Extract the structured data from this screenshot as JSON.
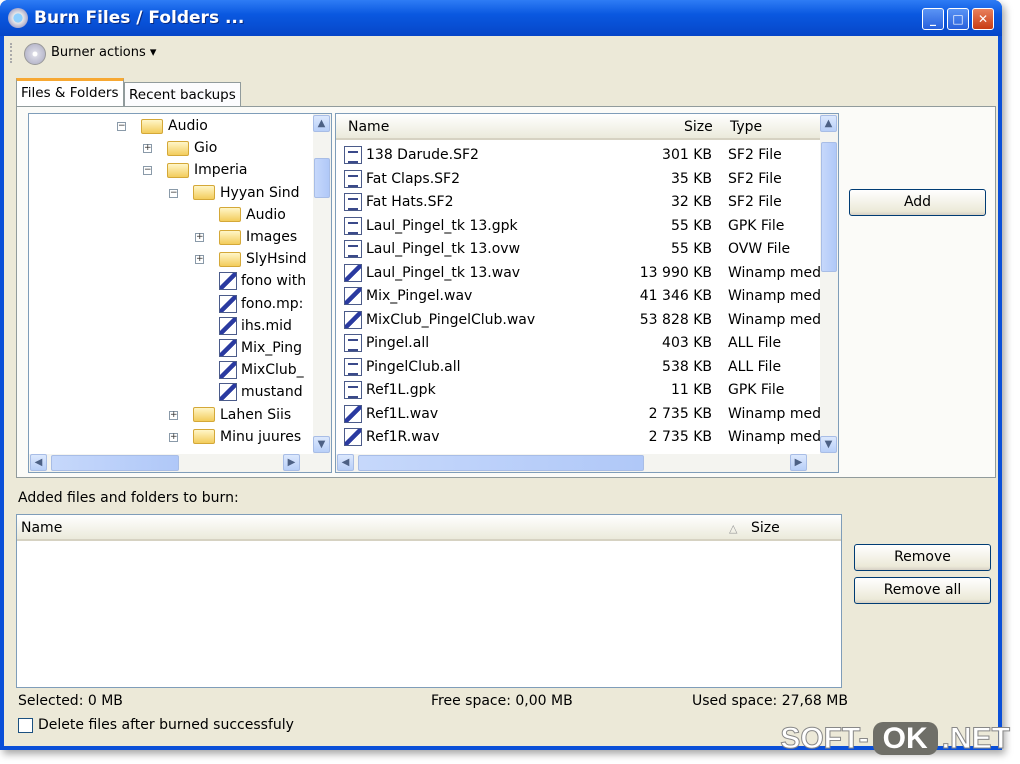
{
  "window": {
    "title": "Burn Files / Folders ...",
    "minimize": "_",
    "maximize": "□",
    "close": "✕"
  },
  "toolbar": {
    "burner_actions": "Burner actions ▾"
  },
  "tabs": [
    {
      "label": "Files & Folders",
      "active": true
    },
    {
      "label": "Recent backups",
      "active": false
    }
  ],
  "tree": [
    {
      "label": "Audio",
      "level": 0,
      "type": "folder",
      "expander": "-"
    },
    {
      "label": "Gio",
      "level": 1,
      "type": "folder",
      "expander": "+"
    },
    {
      "label": "Imperia",
      "level": 1,
      "type": "folder",
      "expander": "-"
    },
    {
      "label": "Hyyan Sind",
      "level": 2,
      "type": "folder",
      "expander": "-"
    },
    {
      "label": "Audio",
      "level": 3,
      "type": "folder",
      "expander": ""
    },
    {
      "label": "Images",
      "level": 3,
      "type": "folder",
      "expander": "+"
    },
    {
      "label": "SlyHsind",
      "level": 3,
      "type": "folder",
      "expander": "+"
    },
    {
      "label": "fono with",
      "level": 3,
      "type": "audio",
      "expander": ""
    },
    {
      "label": "fono.mp:",
      "level": 3,
      "type": "audio",
      "expander": ""
    },
    {
      "label": "ihs.mid",
      "level": 3,
      "type": "audio",
      "expander": ""
    },
    {
      "label": "Mix_Ping",
      "level": 3,
      "type": "audio",
      "expander": ""
    },
    {
      "label": "MixClub_",
      "level": 3,
      "type": "audio",
      "expander": ""
    },
    {
      "label": "mustand",
      "level": 3,
      "type": "audio",
      "expander": ""
    },
    {
      "label": "Lahen Siis",
      "level": 2,
      "type": "folder",
      "expander": "+"
    },
    {
      "label": "Minu juures",
      "level": 2,
      "type": "folder",
      "expander": "+"
    }
  ],
  "file_list": {
    "columns": {
      "name": "Name",
      "size": "Size",
      "type": "Type"
    },
    "rows": [
      {
        "name": "138 Darude.SF2",
        "size": "301 KB",
        "type": "SF2 File",
        "icon": "doc"
      },
      {
        "name": "Fat Claps.SF2",
        "size": "35 KB",
        "type": "SF2 File",
        "icon": "doc"
      },
      {
        "name": "Fat Hats.SF2",
        "size": "32 KB",
        "type": "SF2 File",
        "icon": "doc"
      },
      {
        "name": "Laul_Pingel_tk 13.gpk",
        "size": "55 KB",
        "type": "GPK File",
        "icon": "doc"
      },
      {
        "name": "Laul_Pingel_tk 13.ovw",
        "size": "55 KB",
        "type": "OVW File",
        "icon": "doc"
      },
      {
        "name": "Laul_Pingel_tk 13.wav",
        "size": "13 990 KB",
        "type": "Winamp med",
        "icon": "aud"
      },
      {
        "name": "Mix_Pingel.wav",
        "size": "41 346 KB",
        "type": "Winamp med",
        "icon": "aud"
      },
      {
        "name": "MixClub_PingelClub.wav",
        "size": "53 828 KB",
        "type": "Winamp med",
        "icon": "aud"
      },
      {
        "name": "Pingel.all",
        "size": "403 KB",
        "type": "ALL File",
        "icon": "doc"
      },
      {
        "name": "PingelClub.all",
        "size": "538 KB",
        "type": "ALL File",
        "icon": "doc"
      },
      {
        "name": "Ref1L.gpk",
        "size": "11 KB",
        "type": "GPK File",
        "icon": "doc"
      },
      {
        "name": "Ref1L.wav",
        "size": "2 735 KB",
        "type": "Winamp med",
        "icon": "aud"
      },
      {
        "name": "Ref1R.wav",
        "size": "2 735 KB",
        "type": "Winamp med",
        "icon": "aud"
      }
    ]
  },
  "add_button": "Add",
  "burn_list": {
    "label": "Added files and folders to burn:",
    "columns": {
      "name": "Name",
      "sort": "△",
      "size": "Size"
    }
  },
  "remove_button": "Remove",
  "remove_all_button": "Remove all",
  "status": {
    "selected": "Selected: 0 MB",
    "free": "Free space: 0,00 MB",
    "used": "Used space: 27,68 MB"
  },
  "delete_checkbox": {
    "label": "Delete files after burned successfuly",
    "checked": false
  },
  "watermark": {
    "a": "SOFT-",
    "b": "OK",
    ".c": "",
    "c": ".NET"
  }
}
